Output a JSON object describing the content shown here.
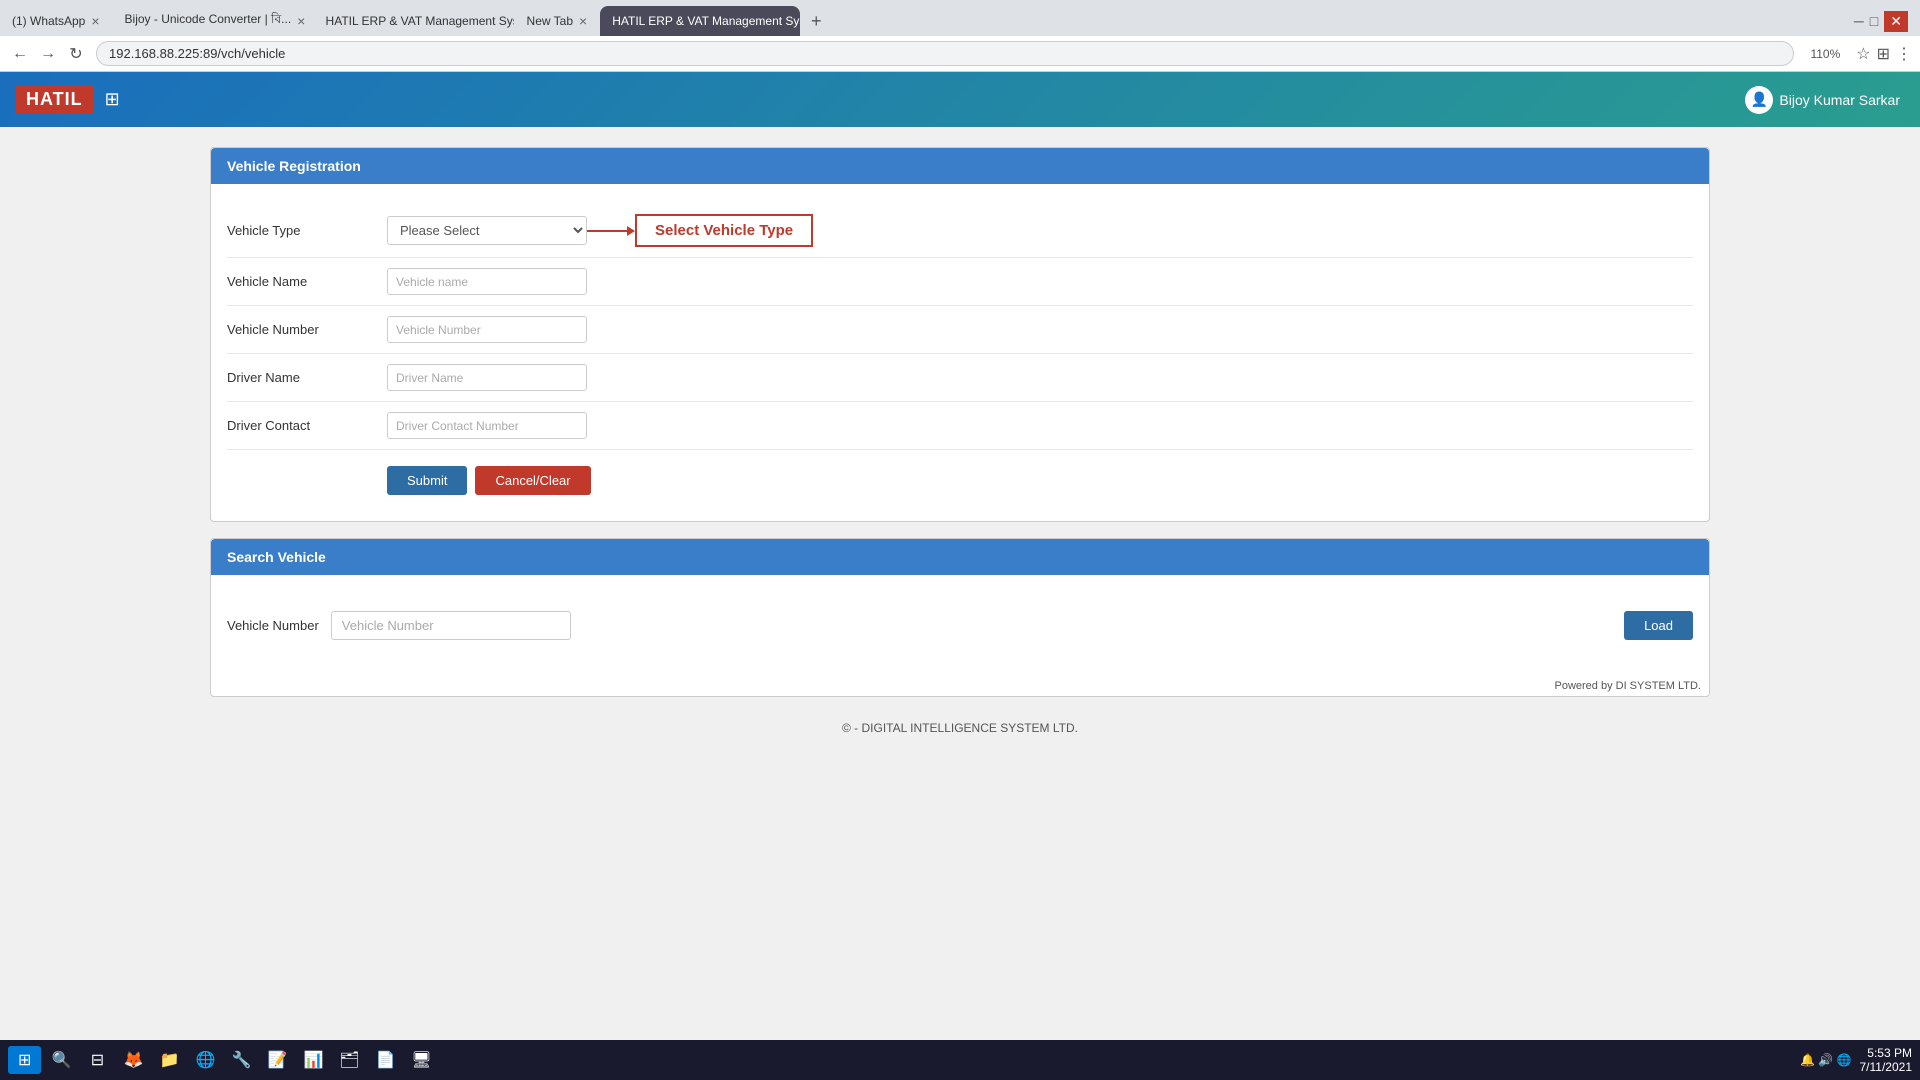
{
  "browser": {
    "tabs": [
      {
        "label": "(1) WhatsApp",
        "active": false,
        "id": "tab-whatsapp"
      },
      {
        "label": "Bijoy - Unicode Converter | বি...",
        "active": false,
        "id": "tab-bijoy"
      },
      {
        "label": "HATIL ERP & VAT Management Syste...",
        "active": false,
        "id": "tab-hatil1"
      },
      {
        "label": "New Tab",
        "active": false,
        "id": "tab-newtab"
      },
      {
        "label": "HATIL ERP & VAT Management Syst...",
        "active": true,
        "id": "tab-hatil2"
      }
    ],
    "url": "192.168.88.225:89/vch/vehicle",
    "zoom": "110%"
  },
  "topnav": {
    "logo": "HATIL",
    "user": "Bijoy Kumar Sarkar"
  },
  "vehicleRegistration": {
    "title": "Vehicle Registration",
    "fields": {
      "vehicleType": {
        "label": "Vehicle Type",
        "placeholder": "Please Select",
        "options": [
          "Please Select"
        ]
      },
      "vehicleName": {
        "label": "Vehicle Name",
        "placeholder": "Vehicle name"
      },
      "vehicleNumber": {
        "label": "Vehicle Number",
        "placeholder": "Vehicle Number"
      },
      "driverName": {
        "label": "Driver Name",
        "placeholder": "Driver Name"
      },
      "driverContact": {
        "label": "Driver Contact",
        "placeholder": "Driver Contact Number"
      }
    },
    "callout": "Select Vehicle Type",
    "buttons": {
      "submit": "Submit",
      "cancel": "Cancel/Clear"
    }
  },
  "searchVehicle": {
    "title": "Search Vehicle",
    "label": "Vehicle Number",
    "placeholder": "Vehicle Number",
    "loadBtn": "Load"
  },
  "footer": {
    "copyright": "© - DIGITAL INTELLIGENCE SYSTEM LTD.",
    "powered": "Powered by DI SYSTEM LTD."
  },
  "taskbar": {
    "time": "5:53 PM",
    "date": "7/11/2021"
  }
}
